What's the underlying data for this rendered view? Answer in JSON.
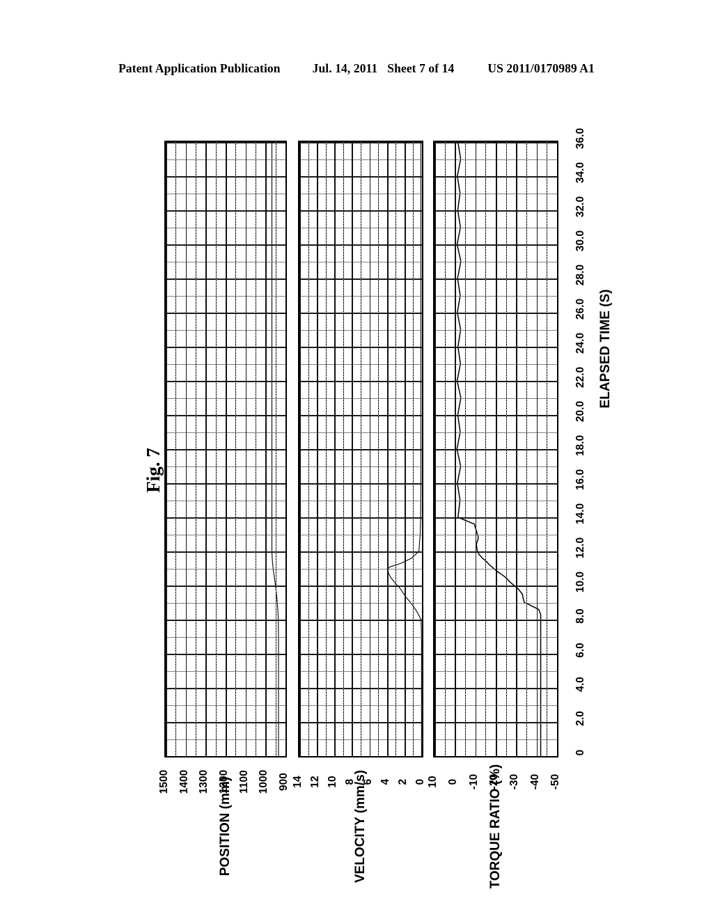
{
  "header": {
    "publication": "Patent Application Publication",
    "date": "Jul. 14, 2011",
    "sheet": "Sheet 7 of 14",
    "patent_number": "US 2011/0170989 A1"
  },
  "figure": {
    "label": "Fig. 7"
  },
  "chart_data": [
    {
      "type": "line",
      "title": "POSITION",
      "ylabel": "POSITION (mm)",
      "xlabel": "ELAPSED TIME (S)",
      "ytick_labels": [
        "1500",
        "1400",
        "1300",
        "1200",
        "1100",
        "1000",
        "900"
      ],
      "ylim": [
        900,
        1500
      ],
      "xlim": [
        0,
        36
      ],
      "xtick_labels": [
        "0",
        "2.0",
        "4.0",
        "6.0",
        "8.0",
        "10.0",
        "12.0",
        "14.0",
        "16.0",
        "18.0",
        "20.0",
        "22.0",
        "24.0",
        "26.0",
        "28.0",
        "30.0",
        "32.0",
        "34.0",
        "36.0"
      ],
      "grid": true,
      "orientation": "time-vertical",
      "series": [
        {
          "name": "position",
          "x": [
            0,
            1,
            2,
            3,
            4,
            5,
            6,
            7,
            8,
            8.5,
            9,
            9.5,
            10,
            10.5,
            11,
            11.5,
            12,
            13,
            14,
            16,
            18,
            20,
            22,
            24,
            26,
            28,
            30,
            32,
            34,
            36
          ],
          "values": [
            935,
            935,
            935,
            935,
            935,
            935,
            935,
            935,
            936,
            938,
            941,
            945,
            950,
            956,
            962,
            966,
            968,
            968,
            968,
            968,
            968,
            968,
            968,
            968,
            968,
            968,
            968,
            968,
            968,
            968
          ]
        }
      ]
    },
    {
      "type": "line",
      "title": "VELOCITY",
      "ylabel": "VELOCITY (mm/s)",
      "xlabel": "ELAPSED TIME (S)",
      "ytick_labels": [
        "14",
        "12",
        "10",
        "8",
        "6",
        "4",
        "2",
        "0"
      ],
      "ylim": [
        0,
        14
      ],
      "xlim": [
        0,
        36
      ],
      "grid": true,
      "orientation": "time-vertical",
      "series": [
        {
          "name": "velocity",
          "x": [
            0,
            1,
            2,
            3,
            4,
            5,
            6,
            7,
            8,
            8.4,
            8.8,
            9.0,
            9.3,
            9.6,
            9.9,
            10.1,
            10.3,
            10.5,
            10.7,
            10.9,
            11.0,
            11.1,
            11.3,
            11.6,
            12.0,
            13,
            14,
            16,
            18,
            20,
            22,
            24,
            26,
            28,
            30,
            32,
            34,
            36
          ],
          "values": [
            0.05,
            0.05,
            0.05,
            0.05,
            0.05,
            0.05,
            0.05,
            0.05,
            0.1,
            0.5,
            1.0,
            1.3,
            1.8,
            2.2,
            2.6,
            3.0,
            3.3,
            3.6,
            3.8,
            3.9,
            3.95,
            3.6,
            2.4,
            1.2,
            0.35,
            0.2,
            0.15,
            0.12,
            0.12,
            0.12,
            0.12,
            0.12,
            0.12,
            0.12,
            0.12,
            0.12,
            0.12,
            0.12
          ]
        }
      ]
    },
    {
      "type": "line",
      "title": "TORQUE RATIO",
      "ylabel": "TORQUE RATIO (%)",
      "xlabel": "ELAPSED TIME (S)",
      "ytick_labels": [
        "10",
        "0",
        "-10",
        "-20",
        "-30",
        "-40",
        "-50"
      ],
      "ylim": [
        -50,
        10
      ],
      "xlim": [
        0,
        36
      ],
      "grid": true,
      "orientation": "time-vertical",
      "series": [
        {
          "name": "torque_ratio",
          "x": [
            0,
            0.5,
            1,
            1.5,
            2,
            2.5,
            3,
            3.5,
            4,
            4.5,
            5,
            5.5,
            6,
            6.5,
            7,
            7.5,
            8,
            8.3,
            8.6,
            8.9,
            9.0,
            9.2,
            9.5,
            9.8,
            10.0,
            10.2,
            10.4,
            10.6,
            10.8,
            11.0,
            11.2,
            11.4,
            11.6,
            11.8,
            12.0,
            12.4,
            12.8,
            13.2,
            13.6,
            14,
            15,
            16,
            17,
            18,
            19,
            20,
            21,
            22,
            23,
            24,
            25,
            26,
            27,
            28,
            29,
            30,
            31,
            32,
            33,
            34,
            35,
            36
          ],
          "values": [
            -42,
            -42,
            -42,
            -42,
            -42,
            -42,
            -42,
            -42,
            -42,
            -42,
            -42,
            -42,
            -42,
            -42,
            -42,
            -42,
            -42,
            -42,
            -41,
            -36,
            -34,
            -33.5,
            -33,
            -31,
            -29,
            -27,
            -25.5,
            -23.5,
            -21,
            -19,
            -17,
            -15.5,
            -13.5,
            -12,
            -11,
            -10.5,
            -11.5,
            -10.5,
            -9.5,
            -1.5,
            -2.5,
            -1.2,
            -2.8,
            -1.0,
            -2.6,
            -1.4,
            -2.9,
            -1.1,
            -2.7,
            -1.5,
            -2.8,
            -1.2,
            -2.6,
            -1.3,
            -2.9,
            -1.1,
            -2.7,
            -1.4,
            -2.5,
            -1.2,
            -2.8,
            -1.5
          ]
        }
      ]
    }
  ]
}
